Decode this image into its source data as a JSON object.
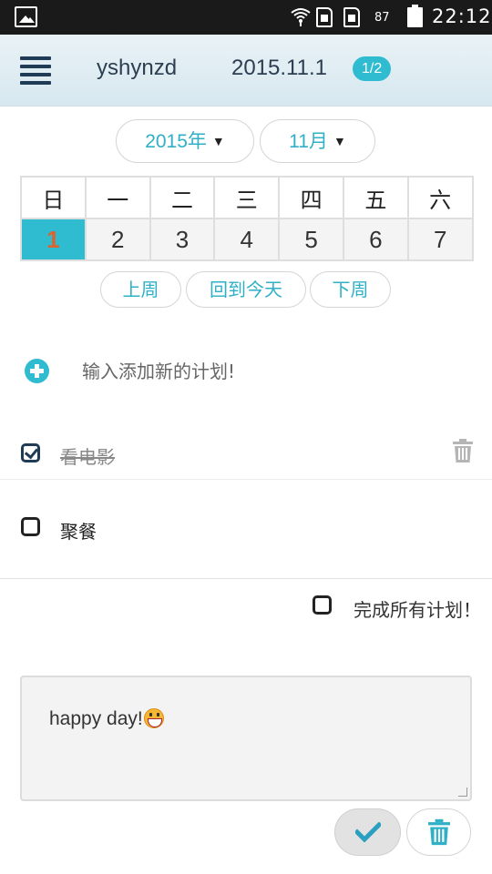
{
  "status_bar": {
    "battery": "87",
    "time": "22:12"
  },
  "header": {
    "user": "yshynzd",
    "date": "2015.11.1",
    "page_badge": "1/2"
  },
  "selectors": {
    "year": "2015年",
    "month": "11月"
  },
  "calendar": {
    "weekdays": [
      "日",
      "一",
      "二",
      "三",
      "四",
      "五",
      "六"
    ],
    "days": [
      "1",
      "2",
      "3",
      "4",
      "5",
      "6",
      "7"
    ],
    "selected_day": "1"
  },
  "week_nav": {
    "prev": "上周",
    "today": "回到今天",
    "next": "下周"
  },
  "add_plan": {
    "placeholder": "输入添加新的计划!"
  },
  "plans": [
    {
      "text": "看电影",
      "done": true
    },
    {
      "text": "聚餐",
      "done": false
    }
  ],
  "complete_all": {
    "label": "完成所有计划！"
  },
  "note": {
    "text": "happy day!"
  },
  "colors": {
    "accent": "#2fbcd1",
    "today_number": "#e0622c",
    "header_bg": "#dcebf2",
    "icon_dark": "#1f3b55"
  },
  "icons": {
    "menu": "hamburger-icon",
    "add": "plus-circle-icon",
    "delete": "trash-icon",
    "confirm": "checkmark-icon"
  }
}
